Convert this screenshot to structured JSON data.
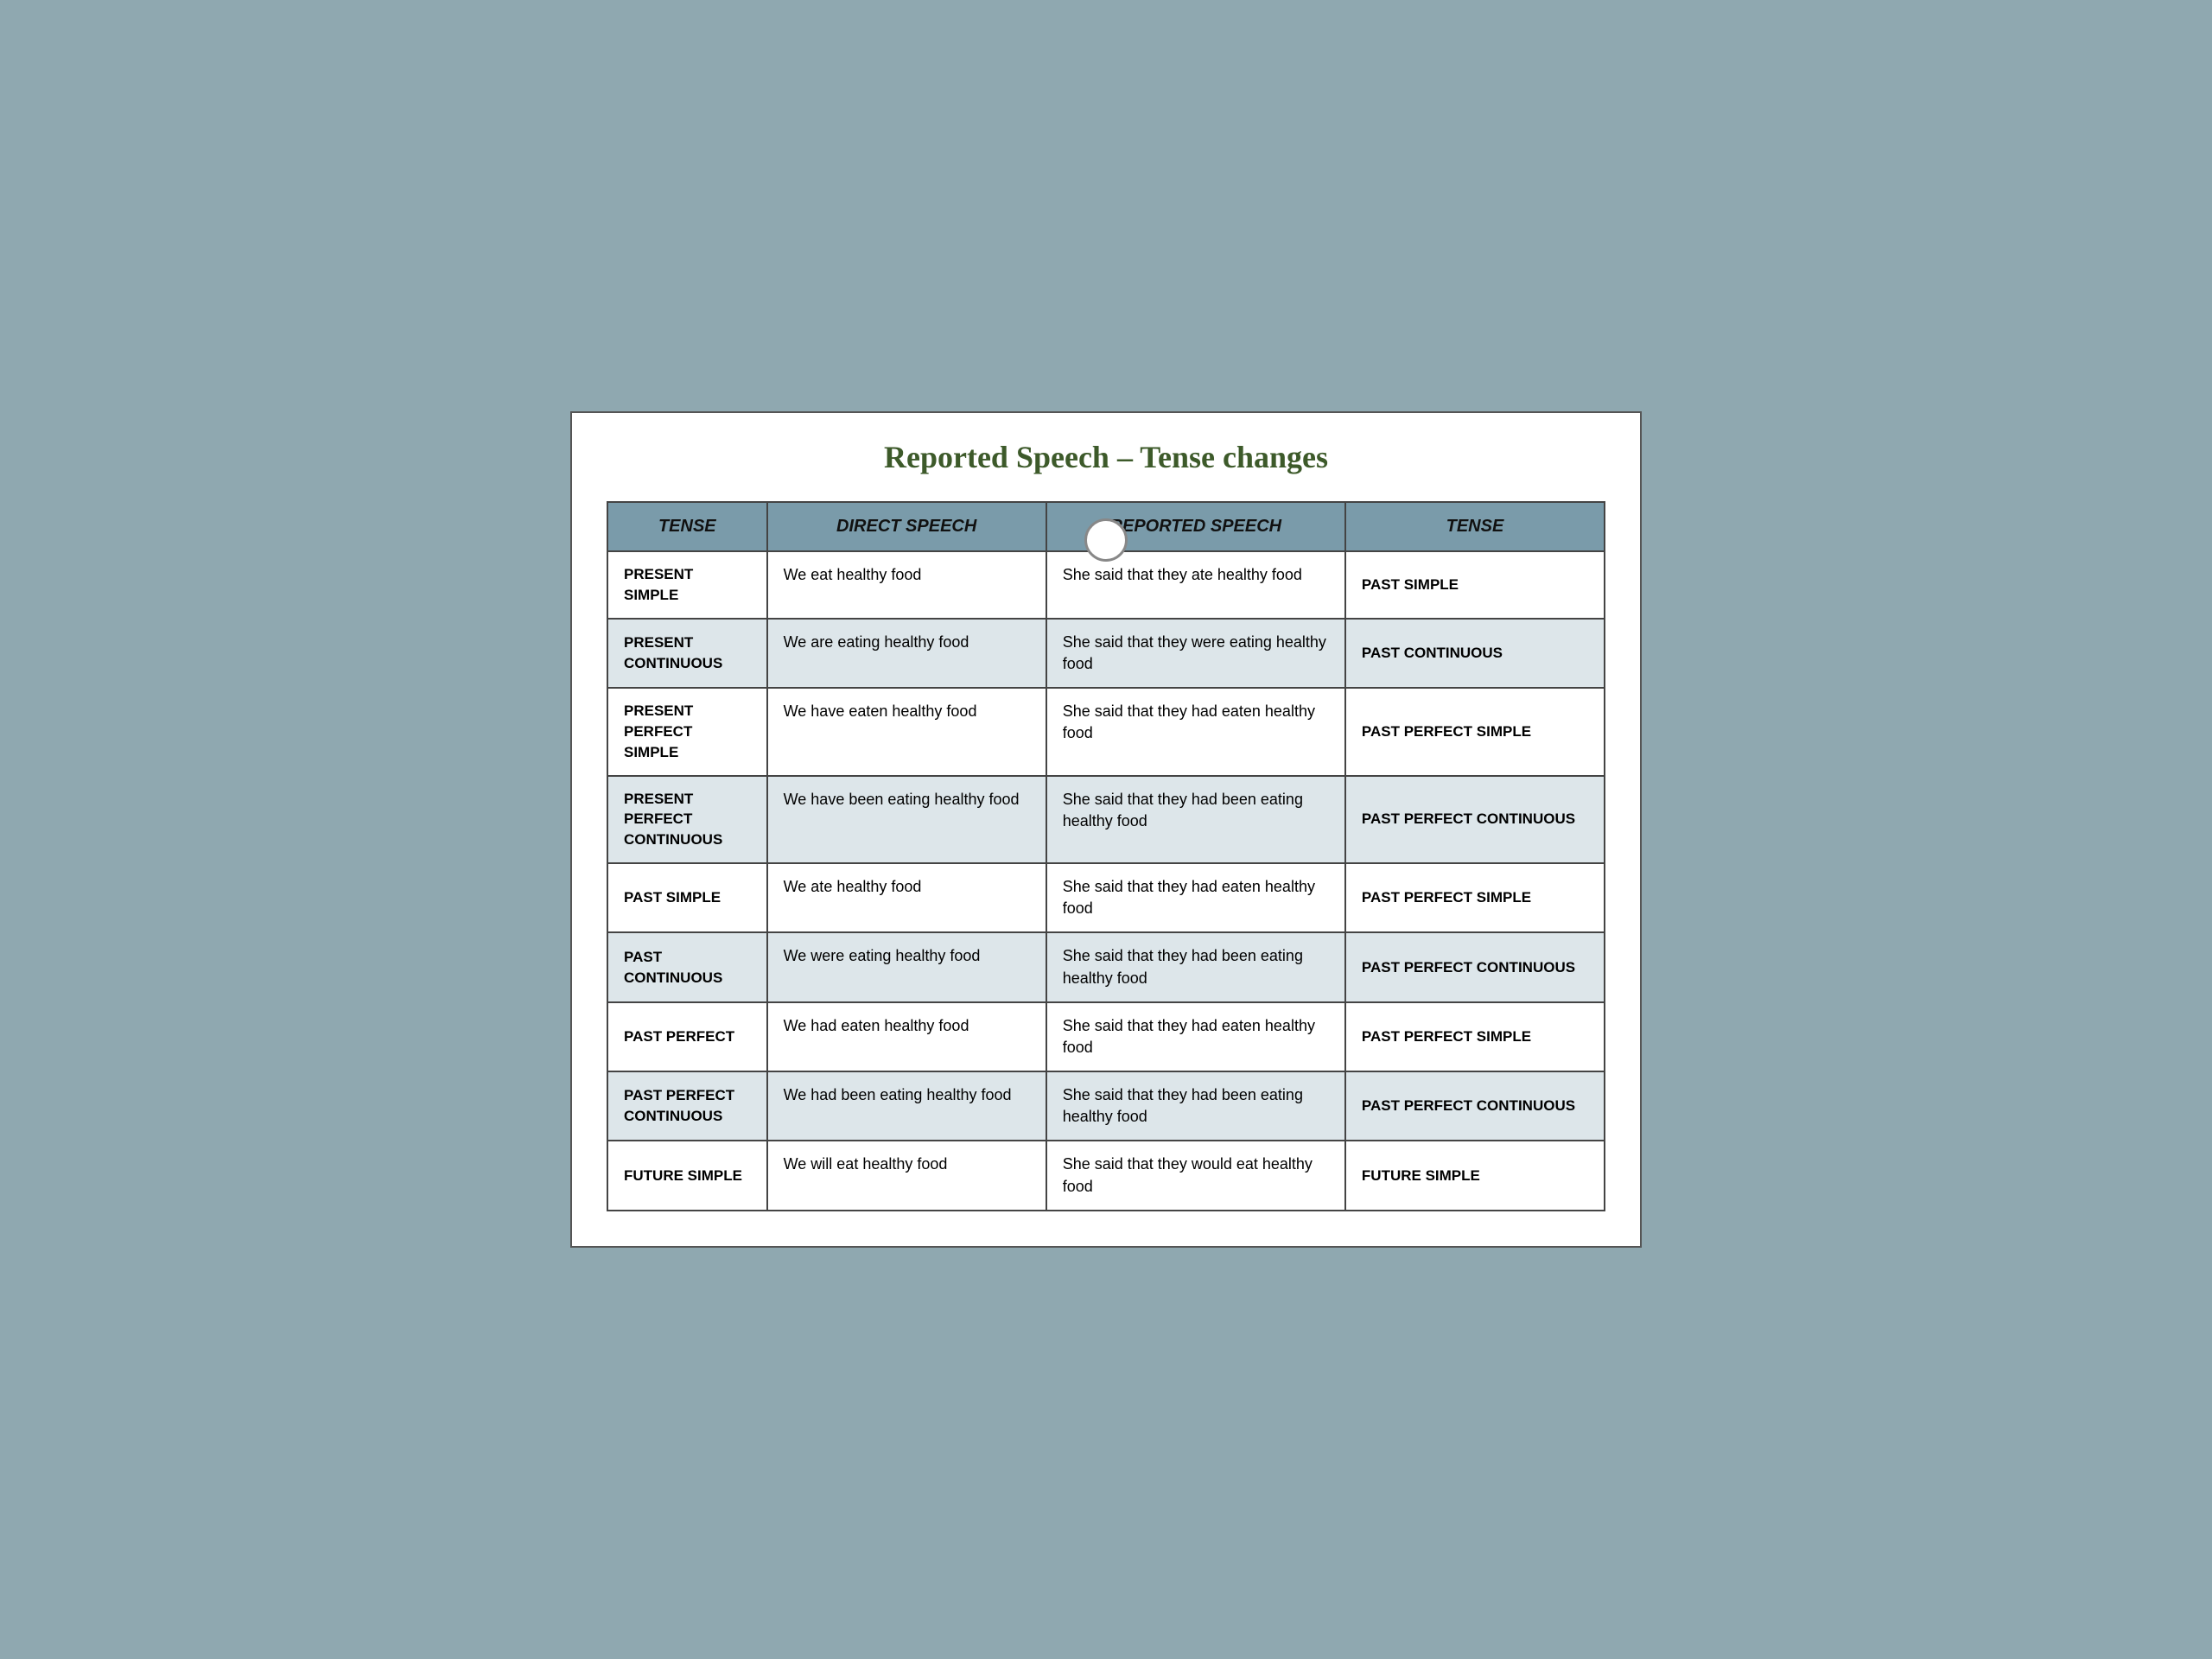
{
  "title": "Reported Speech – Tense changes",
  "headers": {
    "tense_left": "TENSE",
    "direct_speech": "DIRECT SPEECH",
    "reported_speech": "REPORTED SPEECH",
    "tense_right": "TENSE"
  },
  "rows": [
    {
      "tense_left": "PRESENT SIMPLE",
      "direct_speech": "We eat healthy food",
      "reported_speech": "She said that they ate healthy food",
      "tense_right": "PAST SIMPLE"
    },
    {
      "tense_left": "PRESENT CONTINUOUS",
      "direct_speech": "We are eating healthy food",
      "reported_speech": "She said that they were eating healthy food",
      "tense_right": "PAST CONTINUOUS"
    },
    {
      "tense_left": "PRESENT PERFECT SIMPLE",
      "direct_speech": "We have eaten healthy food",
      "reported_speech": "She said that they had eaten healthy food",
      "tense_right": "PAST PERFECT SIMPLE"
    },
    {
      "tense_left": "PRESENT PERFECT CONTINUOUS",
      "direct_speech": "We have been eating healthy food",
      "reported_speech": "She said that they had been eating  healthy food",
      "tense_right": "PAST PERFECT CONTINUOUS"
    },
    {
      "tense_left": "PAST SIMPLE",
      "direct_speech": "We ate healthy food",
      "reported_speech": "She said that they had eaten healthy food",
      "tense_right": "PAST PERFECT SIMPLE"
    },
    {
      "tense_left": "PAST CONTINUOUS",
      "direct_speech": "We were eating healthy food",
      "reported_speech": "She said that they had been eating healthy food",
      "tense_right": "PAST PERFECT CONTINUOUS"
    },
    {
      "tense_left": "PAST PERFECT",
      "direct_speech": "We had eaten healthy food",
      "reported_speech": "She said that they had eaten healthy food",
      "tense_right": "PAST PERFECT SIMPLE"
    },
    {
      "tense_left": "PAST PERFECT CONTINUOUS",
      "direct_speech": "We had been eating healthy food",
      "reported_speech": "She said that they had been eating  healthy food",
      "tense_right": "PAST PERFECT CONTINUOUS"
    },
    {
      "tense_left": "FUTURE SIMPLE",
      "direct_speech": "We will eat healthy food",
      "reported_speech": "She said that they would eat healthy food",
      "tense_right": "FUTURE SIMPLE"
    }
  ]
}
